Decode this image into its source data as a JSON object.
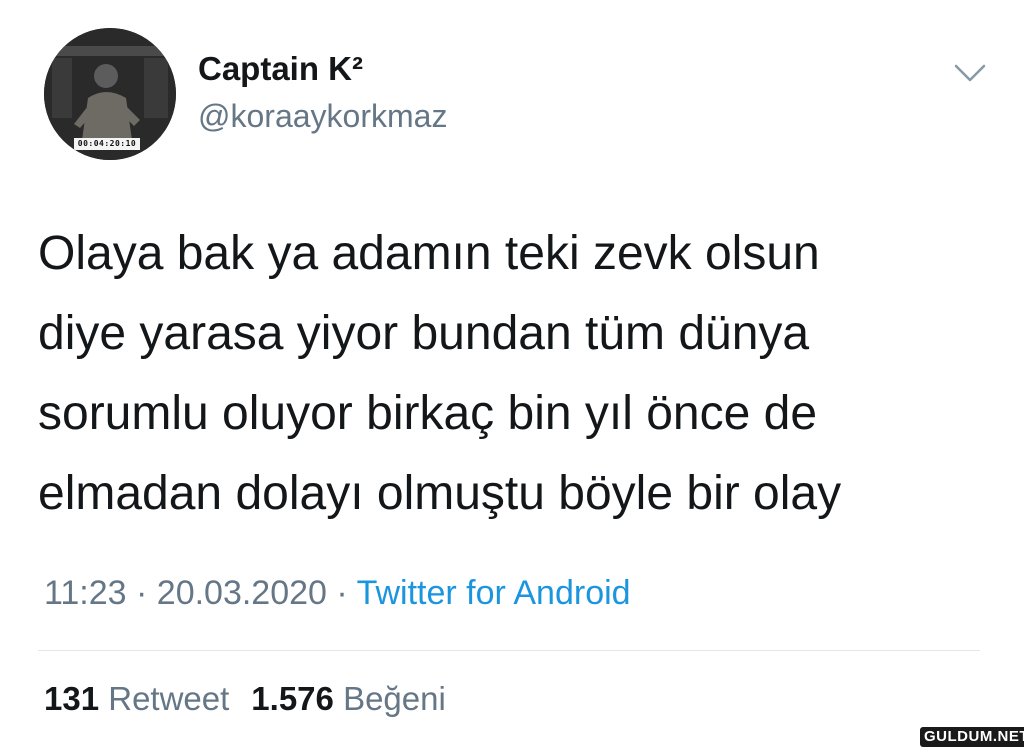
{
  "profile": {
    "display_name": "Captain K²",
    "handle": "@koraaykorkmaz",
    "avatar_timestamp": "00:04:20:10"
  },
  "menu": {
    "icon": "chevron-down-icon"
  },
  "tweet": {
    "lines": [
      "Olaya bak ya adamın teki zevk olsun",
      "diye yarasa yiyor bundan tüm dünya",
      "sorumlu oluyor birkaç bin yıl önce de",
      "elmadan dolayı olmuştu böyle bir olay"
    ]
  },
  "meta": {
    "time": "11:23",
    "separator": " · ",
    "date": "20.03.2020",
    "source": "Twitter for Android"
  },
  "stats": {
    "retweet_count": "131",
    "retweet_label": "Retweet",
    "like_count": "1.576",
    "like_label": "Beğeni"
  },
  "watermark": "GULDUM.NET",
  "colors": {
    "text": "#14171a",
    "secondary": "#657786",
    "link": "#1b95e0",
    "divider": "#e1e8ed"
  }
}
